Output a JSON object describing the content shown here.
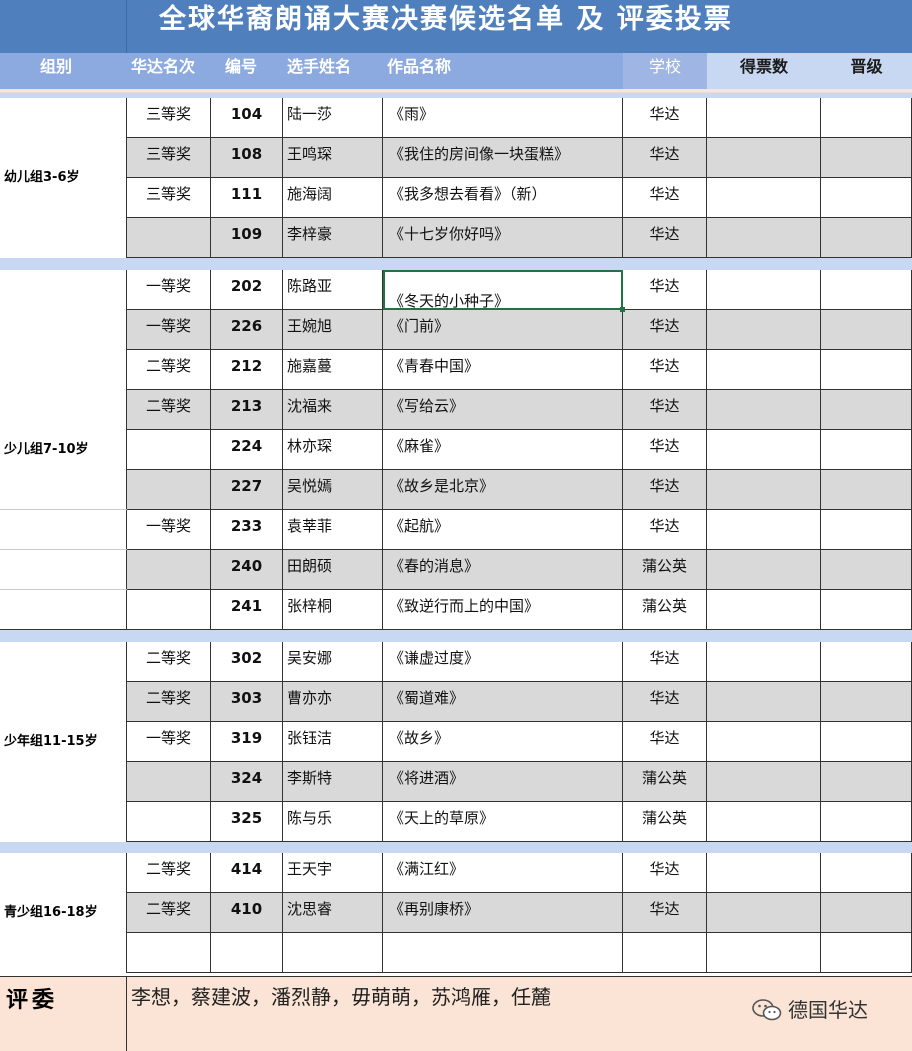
{
  "title": "全球华裔朗诵大赛决赛候选名单 及 评委投票",
  "headers": {
    "group": "组别",
    "award": "华达名次",
    "number": "编号",
    "name": "选手姓名",
    "work": "作品名称",
    "school": "学校",
    "votes": "得票数",
    "advance": "晋级"
  },
  "groups": [
    {
      "label": "幼儿组3-6岁"
    },
    {
      "label": "少儿组7-10岁"
    },
    {
      "label": "少年组11-15岁"
    },
    {
      "label": "青少组16-18岁"
    }
  ],
  "rows": [
    {
      "award": "三等奖",
      "number": "104",
      "name": "陆一莎",
      "work": "《雨》",
      "school": "华达"
    },
    {
      "award": "三等奖",
      "number": "108",
      "name": "王鸣琛",
      "work": "《我住的房间像一块蛋糕》",
      "school": "华达"
    },
    {
      "award": "三等奖",
      "number": "111",
      "name": "施海阔",
      "work": "《我多想去看看》（新）",
      "school": "华达"
    },
    {
      "award": "",
      "number": "109",
      "name": "李梓豪",
      "work": "《十七岁你好吗》",
      "school": "华达"
    },
    {
      "award": "一等奖",
      "number": "202",
      "name": "陈路亚",
      "work": "《冬天的小种子》",
      "school": "华达"
    },
    {
      "award": "一等奖",
      "number": "226",
      "name": "王婉旭",
      "work": "《门前》",
      "school": "华达"
    },
    {
      "award": "二等奖",
      "number": "212",
      "name": "施嘉蔓",
      "work": "《青春中国》",
      "school": "华达"
    },
    {
      "award": "二等奖",
      "number": "213",
      "name": "沈福来",
      "work": "《写给云》",
      "school": "华达"
    },
    {
      "award": "",
      "number": "224",
      "name": "林亦琛",
      "work": "《麻雀》",
      "school": "华达"
    },
    {
      "award": "",
      "number": "227",
      "name": "吴悦嫣",
      "work": "《故乡是北京》",
      "school": "华达"
    },
    {
      "award": "一等奖",
      "number": "233",
      "name": "袁莘菲",
      "work": "《起航》",
      "school": "华达"
    },
    {
      "award": "",
      "number": "240",
      "name": "田朗硕",
      "work": "《春的消息》",
      "school": "蒲公英"
    },
    {
      "award": "",
      "number": "241",
      "name": "张梓桐",
      "work": "《致逆行而上的中国》",
      "school": "蒲公英"
    },
    {
      "award": "二等奖",
      "number": "302",
      "name": "吴安娜",
      "work": "《谦虚过度》",
      "school": "华达"
    },
    {
      "award": "二等奖",
      "number": "303",
      "name": "曹亦亦",
      "work": "《蜀道难》",
      "school": "华达"
    },
    {
      "award": "一等奖",
      "number": "319",
      "name": "张钰洁",
      "work": "《故乡》",
      "school": "华达"
    },
    {
      "award": "",
      "number": "324",
      "name": "李斯特",
      "work": "《将进酒》",
      "school": "蒲公英"
    },
    {
      "award": "",
      "number": "325",
      "name": "陈与乐",
      "work": "《天上的草原》",
      "school": "蒲公英"
    },
    {
      "award": "二等奖",
      "number": "414",
      "name": "王天宇",
      "work": "《满江红》",
      "school": "华达"
    },
    {
      "award": "二等奖",
      "number": "410",
      "name": "沈思睿",
      "work": "《再别康桥》",
      "school": "华达"
    },
    {
      "award": "",
      "number": "",
      "name": "",
      "work": "",
      "school": ""
    }
  ],
  "judges": {
    "label": "评委",
    "names": "李想，蔡建波，潘烈静，毋萌萌，苏鸿雁，任麓"
  },
  "watermark": {
    "text": "德国华达",
    "icon": "wechat-icon"
  },
  "colors": {
    "title_bg": "#4f80bd",
    "header_blue": "#8ca9e0",
    "header_light": "#c8d7f2",
    "row_grey": "#d9d9d9",
    "judges_bg": "#fbe4d5",
    "selection": "#217346"
  }
}
